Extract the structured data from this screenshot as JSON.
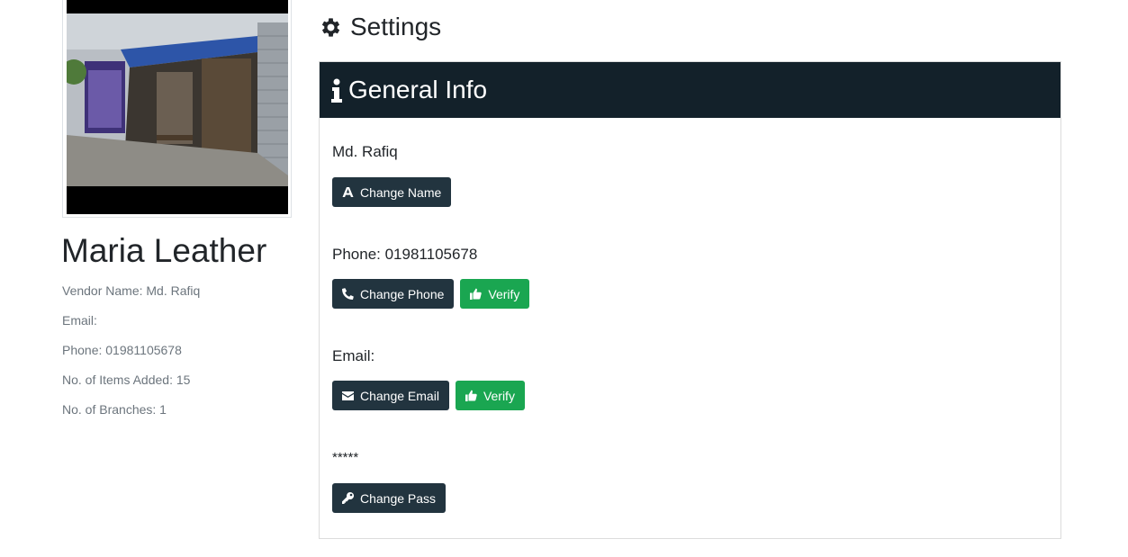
{
  "store": {
    "name": "Maria Leather",
    "photo_alt": "storefront-photo"
  },
  "vendor_info": {
    "vendor_name": "Vendor Name: Md. Rafiq",
    "email": "Email:",
    "phone": "Phone: 01981105678",
    "items_added": "No. of Items Added: 15",
    "branches": "No. of Branches: 1"
  },
  "settings": {
    "title": "Settings",
    "title_icon": "gear-icon"
  },
  "general_info": {
    "header": "General Info",
    "header_icon": "info-icon",
    "name_value": "Md. Rafiq",
    "change_name_label": "Change Name",
    "change_name_icon": "font-icon",
    "phone_value": "Phone: 01981105678",
    "change_phone_label": "Change Phone",
    "change_phone_icon": "phone-icon",
    "verify_phone_label": "Verify",
    "verify_icon": "thumbs-up-icon",
    "email_value": "Email:",
    "change_email_label": "Change Email",
    "change_email_icon": "envelope-icon",
    "verify_email_label": "Verify",
    "password_value": "*****",
    "change_pass_label": "Change Pass",
    "change_pass_icon": "key-icon"
  },
  "colors": {
    "header_bg": "#13212a",
    "dark_button": "#22343f",
    "verify_button": "#1aa651"
  }
}
